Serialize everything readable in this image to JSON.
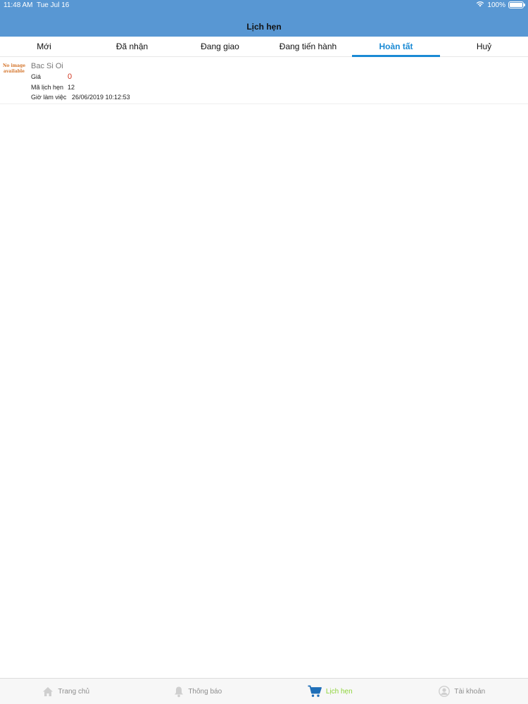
{
  "status_bar": {
    "time": "11:48 AM",
    "date": "Tue Jul 16",
    "battery": "100%",
    "battery_level": 1.0,
    "wifi_icon": "wifi-icon",
    "battery_icon": "battery-icon"
  },
  "header": {
    "title": "Lịch hẹn",
    "background": "#5897d3"
  },
  "tabs": [
    {
      "label": "Mới"
    },
    {
      "label": "Đã nhận"
    },
    {
      "label": "Đang giao"
    },
    {
      "label": "Đang tiến hành"
    },
    {
      "label": "Hoàn tất"
    },
    {
      "label": "Huỷ"
    }
  ],
  "active_tab": "Hoàn tất",
  "accent_color": "#1a8ad4",
  "appointment": {
    "placeholder_line1": "No image",
    "placeholder_line2": "available",
    "title": "Bac Si Oi",
    "price_label": "Giá",
    "price_value": "0",
    "code_label": "Mã lịch hẹn",
    "code_value": "12",
    "time_label": "Giờ làm việc",
    "time_value": "26/06/2019 10:12:53",
    "price_color": "#d0351f"
  },
  "bottom_nav": [
    {
      "label": "Trang chủ",
      "icon": "home-icon"
    },
    {
      "label": "Thông báo",
      "icon": "bell-icon"
    },
    {
      "label": "Lịch hẹn",
      "icon": "cart-icon"
    },
    {
      "label": "Tài khoản",
      "icon": "user-icon"
    }
  ],
  "bottom_nav_active_color": "#8ed43a"
}
